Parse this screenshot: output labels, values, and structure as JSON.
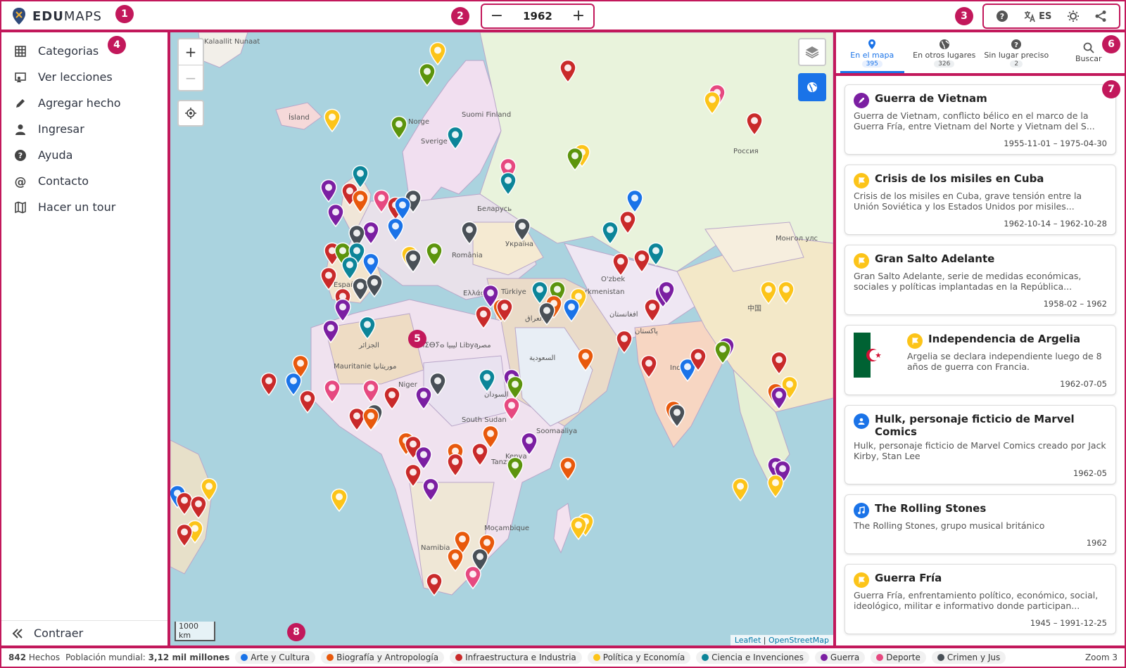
{
  "header": {
    "brand_bold": "EDU",
    "brand_light": "MAPS",
    "year": "1962",
    "decrement": "−",
    "increment": "+",
    "lang": "ES"
  },
  "sidebar": {
    "items": [
      {
        "label": "Categorias",
        "icon": "grid-icon"
      },
      {
        "label": "Ver lecciones",
        "icon": "lessons-icon"
      },
      {
        "label": "Agregar hecho",
        "icon": "pencil-icon"
      },
      {
        "label": "Ingresar",
        "icon": "user-icon"
      },
      {
        "label": "Ayuda",
        "icon": "help-icon"
      },
      {
        "label": "Contacto",
        "icon": "at-icon"
      },
      {
        "label": "Hacer un tour",
        "icon": "map-icon"
      }
    ],
    "collapse": "Contraer"
  },
  "map": {
    "labels": {
      "kalaallit": "Kalaallit Nunaat",
      "island": "Ísland",
      "suomi": "Suomi Finland",
      "rossiya": "Россия",
      "belarus": "Беларусь",
      "ukraina": "Україна",
      "mongol": "Монгол улс",
      "turkmenistan": "Turkmenistan",
      "libya": "ⵍⵉⴱⵢⴰ ليبيا Libya",
      "niger": "Niger",
      "south_sudan": "South Sudan",
      "kenya": "Kenya",
      "india": "India",
      "china": "中国",
      "namibia": "Namibia",
      "mocambique": "Moçambique",
      "sverige": "Sverige",
      "misr": "مصر",
      "saudi": "السعودية",
      "afghanistan": "افغانستان",
      "pakistan": "پاکستان",
      "iraq": "العراق",
      "turkiye": "Türkiye",
      "espana": "España",
      "uzbekistan": "O'zbek",
      "tanzania": "Tanzania",
      "somalia": "Soomaaliya",
      "sudan": "السودان",
      "mauritanie": "Mauritanie موريتانيا",
      "algeria": "الجزائر",
      "norge": "Norge",
      "elllas": "Ελλάς",
      "romania": "România"
    },
    "scale": "1000 km",
    "attrib_leaflet": "Leaflet",
    "attrib_sep": " | ",
    "attrib_osm": "OpenStreetMap",
    "colors": {
      "arte": "#1a73e8",
      "biografia": "#e8590c",
      "infra": "#c92a2a",
      "politica": "#fcc419",
      "ciencia": "#0c8599",
      "guerra": "#7b1fa2",
      "deporte": "#e64980",
      "crimen": "#495057",
      "naturaleza": "#5c940d"
    }
  },
  "tabs": [
    {
      "label": "En el mapa",
      "count": "395",
      "icon": "pin-icon"
    },
    {
      "label": "En otros lugares",
      "count": "326",
      "icon": "globe-icon"
    },
    {
      "label": "Sin lugar preciso",
      "count": "2",
      "icon": "question-icon"
    },
    {
      "label": "Buscar",
      "count": "",
      "icon": "search-icon"
    }
  ],
  "cards": [
    {
      "title": "Guerra de Vietnam",
      "desc": "Guerra de Vietnam, conflicto bélico en el marco de la Guerra Fría, entre Vietnam del Norte y Vietnam del S...",
      "date": "1955-11-01 – 1975-04-30",
      "cat_color": "#7b1fa2",
      "icon": "rocket-icon"
    },
    {
      "title": "Crisis de los misiles en Cuba",
      "desc": "Crisis de los misiles en Cuba, grave tensión entre la Unión Soviética y los Estados Unidos por misiles...",
      "date": "1962-10-14 – 1962-10-28",
      "cat_color": "#fcc419",
      "icon": "flag-icon"
    },
    {
      "title": "Gran Salto Adelante",
      "desc": "Gran Salto Adelante, serie de medidas económicas, sociales y políticas implantadas en la República...",
      "date": "1958-02 – 1962",
      "cat_color": "#fcc419",
      "icon": "flag-icon"
    },
    {
      "title": "Independencia de Argelia",
      "desc": "Argelia se declara independiente luego de 8 años de guerra con Francia.",
      "date": "1962-07-05",
      "cat_color": "#fcc419",
      "icon": "flag-icon"
    },
    {
      "title": "Hulk, personaje ficticio de Marvel Comics",
      "desc": "Hulk, personaje ficticio de Marvel Comics creado por Jack Kirby, Stan Lee",
      "date": "1962-05",
      "cat_color": "#1a73e8",
      "icon": "person-icon"
    },
    {
      "title": "The Rolling Stones",
      "desc": "The Rolling Stones, grupo musical británico",
      "date": "1962",
      "cat_color": "#1a73e8",
      "icon": "music-icon"
    },
    {
      "title": "Guerra Fría",
      "desc": "Guerra Fría, enfrentamiento político, económico, social, ideológico, militar e informativo donde participan...",
      "date": "1945 – 1991-12-25",
      "cat_color": "#fcc419",
      "icon": "flag-icon"
    }
  ],
  "footer": {
    "count": "842",
    "count_label": "Hechos",
    "pop_label": "Población mundial:",
    "pop_value": "3,12 mil millones",
    "chips": [
      {
        "label": "Arte y Cultura",
        "color": "#1a73e8"
      },
      {
        "label": "Biografía y Antropología",
        "color": "#e8590c"
      },
      {
        "label": "Infraestructura e Industria",
        "color": "#c92a2a"
      },
      {
        "label": "Política y Economía",
        "color": "#fcc419"
      },
      {
        "label": "Ciencia e Invenciones",
        "color": "#0c8599"
      },
      {
        "label": "Guerra",
        "color": "#7b1fa2"
      },
      {
        "label": "Deporte",
        "color": "#e64980"
      },
      {
        "label": "Crimen y Jus",
        "color": "#495057"
      }
    ],
    "zoom": "Zoom 3"
  },
  "annotations": [
    "1",
    "2",
    "3",
    "4",
    "5",
    "6",
    "7",
    "8"
  ]
}
